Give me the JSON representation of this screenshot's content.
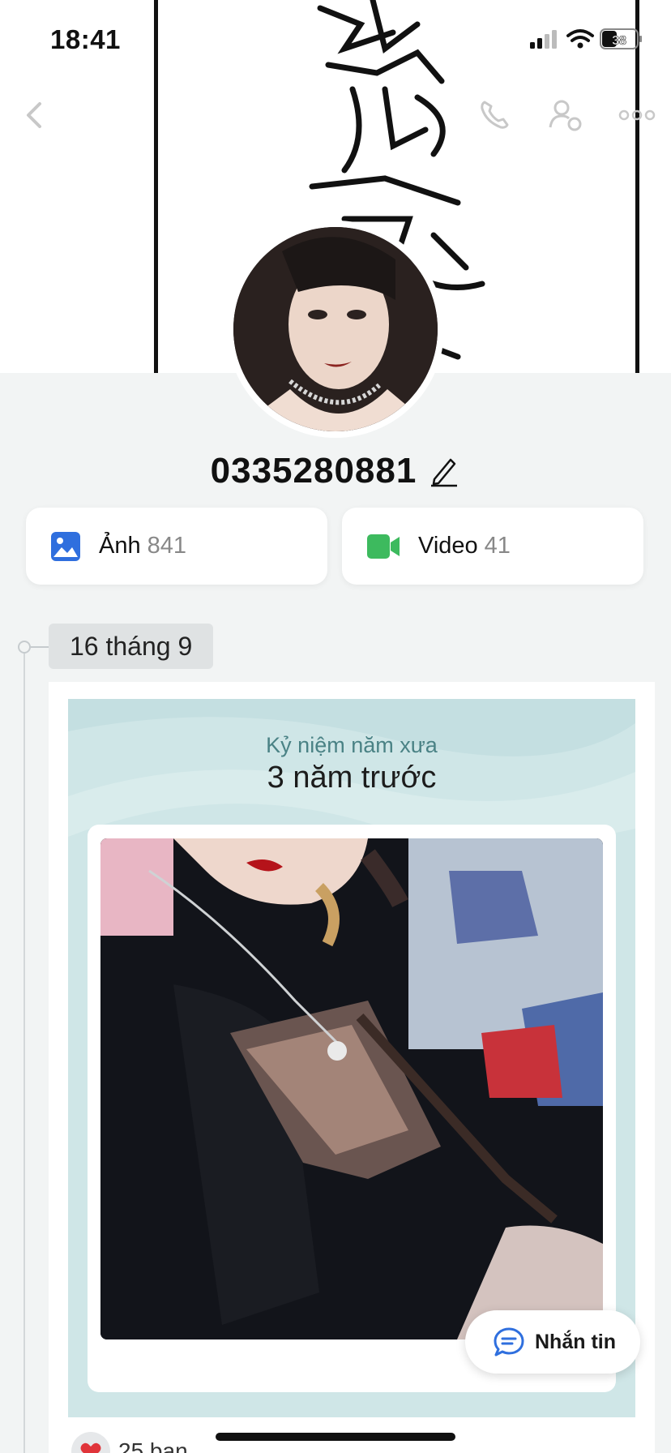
{
  "status_bar": {
    "time": "18:41",
    "battery": "38"
  },
  "header": {
    "icons": [
      "back-icon",
      "phone-icon",
      "profile-settings-icon",
      "more-icon"
    ]
  },
  "profile": {
    "name": "0335280881"
  },
  "media": [
    {
      "label": "Ảnh",
      "count": "841",
      "icon": "image-icon",
      "color": "#2f6fde"
    },
    {
      "label": "Video",
      "count": "41",
      "icon": "video-icon",
      "color": "#3dba5e"
    }
  ],
  "timeline": {
    "date": "16 tháng 9",
    "memory": {
      "subtitle": "Kỷ niệm năm xưa",
      "title": "3 năm trước"
    }
  },
  "reactions": {
    "text": "25 bạn"
  },
  "chat_button": {
    "label": "Nhắn tin"
  }
}
